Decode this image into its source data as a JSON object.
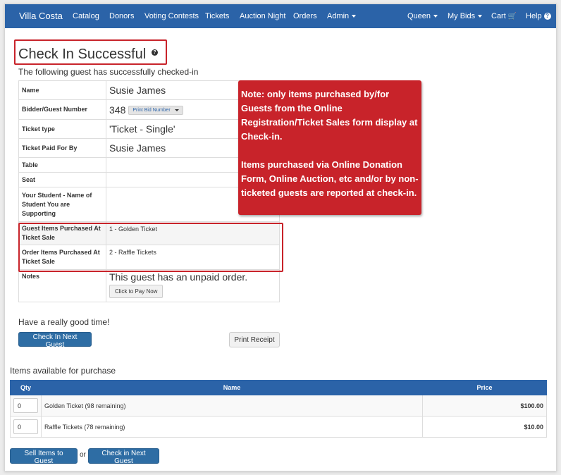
{
  "navbar": {
    "brand": "Villa Costa",
    "left_items": [
      "Catalog",
      "Donors",
      "Voting Contests",
      "Tickets",
      "Auction Night",
      "Orders",
      "Admin"
    ],
    "right_items": {
      "user": "Queen",
      "my_bids": "My Bids",
      "cart": "Cart",
      "help": "Help"
    },
    "color": "#2b63a8"
  },
  "header": {
    "title": "Check In Successful",
    "help_glyph": "?",
    "subtitle": "The following guest has successfully checked-in"
  },
  "guest_info": {
    "rows": [
      {
        "label": "Name",
        "value": "Susie James"
      },
      {
        "label": "Bidder/Guest Number",
        "value": "348",
        "dropdown": "Print Bid Number"
      },
      {
        "label": "Ticket type",
        "value": "'Ticket - Single'"
      },
      {
        "label": "Ticket Paid For By",
        "value": "Susie James"
      },
      {
        "label": "Table",
        "value": ""
      },
      {
        "label": "Seat",
        "value": ""
      },
      {
        "label": "Your Student - Name of Student You are Supporting",
        "value": ""
      },
      {
        "label": "Guest Items Purchased At Ticket Sale",
        "value": "1 - Golden Ticket"
      },
      {
        "label": "Order Items Purchased At Ticket Sale",
        "value": "2 - Raffle Tickets"
      },
      {
        "label": "Notes",
        "value": "This guest has an unpaid order.",
        "button": "Click to Pay Now"
      }
    ]
  },
  "note": {
    "paragraph1": "Note: only items purchased by/for Guests from the Online Registration/Ticket Sales form display at Check-in.",
    "paragraph2": "Items purchased via Online Donation Form, Online Auction, etc and/or by non-ticketed guests are reported at check-in.",
    "color": "#c8232a"
  },
  "actions": {
    "message": "Have a really good time!",
    "check_in_next": "Check In Next Guest",
    "print_receipt": "Print Receipt"
  },
  "purchase": {
    "heading": "Items available for purchase",
    "columns": [
      "Qty",
      "Name",
      "Price"
    ],
    "rows": [
      {
        "qty": "0",
        "name": "Golden Ticket (98 remaining)",
        "price": "$100.00"
      },
      {
        "qty": "0",
        "name": "Raffle Tickets (78 remaining)",
        "price": "$10.00"
      }
    ],
    "sell_button": "Sell Items to Guest",
    "or_text": "or",
    "check_in_button": "Check in Next Guest"
  }
}
